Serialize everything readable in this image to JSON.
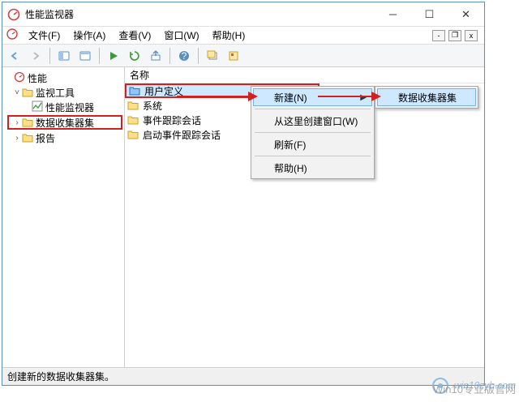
{
  "titlebar": {
    "title": "性能监视器"
  },
  "menubar": {
    "items": [
      "文件(F)",
      "操作(A)",
      "查看(V)",
      "窗口(W)",
      "帮助(H)"
    ]
  },
  "tree": {
    "root": "性能",
    "monitor_tools": "监视工具",
    "perf_monitor": "性能监视器",
    "collector_sets": "数据收集器集",
    "reports": "报告"
  },
  "content": {
    "column": "名称",
    "rows": {
      "user_defined": "用户定义",
      "system": "系统",
      "event_trace": "事件跟踪会话",
      "startup_trace": "启动事件跟踪会话"
    }
  },
  "context_menu": {
    "new": "新建(N)",
    "new_window": "从这里创建窗口(W)",
    "refresh": "刷新(F)",
    "help": "帮助(H)"
  },
  "submenu": {
    "collector_set": "数据收集器集"
  },
  "statusbar": {
    "text": "创建新的数据收集器集。"
  },
  "watermark": "win10zyb.com",
  "watermark2": "Win10专业版官网"
}
